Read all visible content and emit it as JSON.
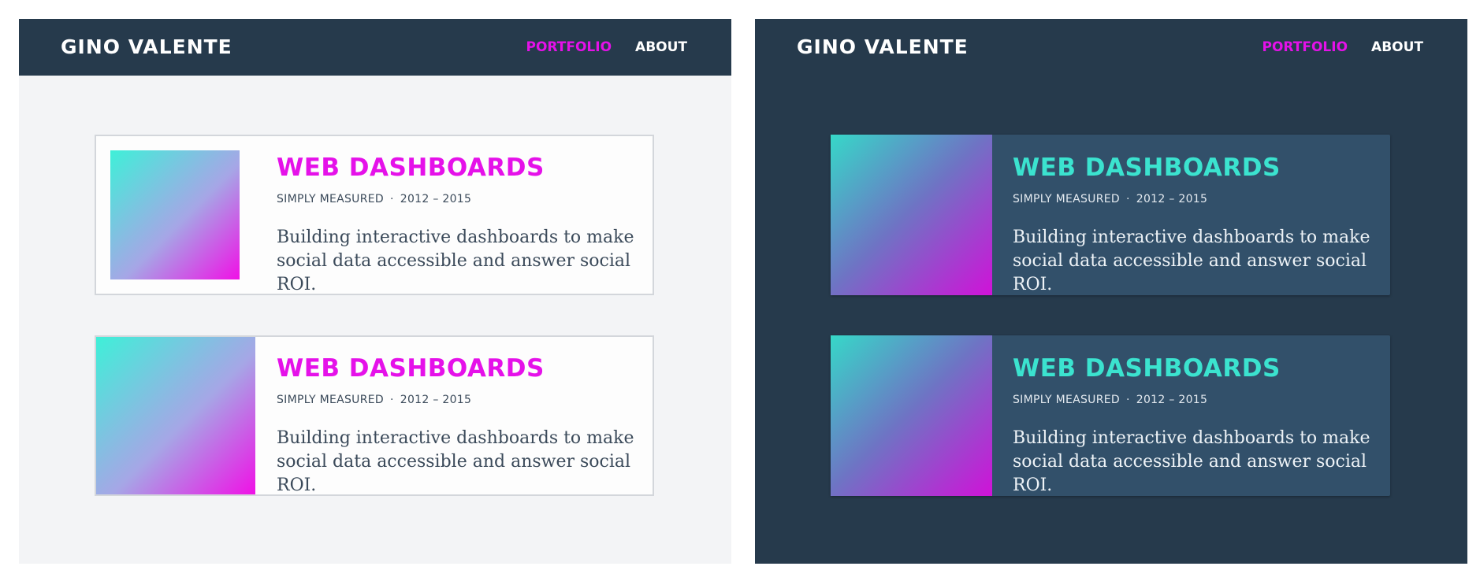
{
  "colors": {
    "navy": "#263a4c",
    "magenta_accent": "#e511e9",
    "teal_accent": "#3be3cf",
    "light_background": "#f3f4f6",
    "dark_card": "#32506a"
  },
  "themes": [
    {
      "name": "light",
      "nav": {
        "brand": "GINO VALENTE",
        "links": [
          {
            "label": "PORTFOLIO",
            "active": true
          },
          {
            "label": "ABOUT",
            "active": false
          }
        ]
      },
      "cards": [
        {
          "title": "WEB DASHBOARDS",
          "company": "SIMPLY MEASURED",
          "separator": "·",
          "years": "2012 – 2015",
          "description": "Building interactive dashboards to make social data accessible and answer social ROI."
        },
        {
          "title": "WEB DASHBOARDS",
          "company": "SIMPLY MEASURED",
          "separator": "·",
          "years": "2012 – 2015",
          "description": "Building interactive dashboards to make social data accessible and answer social ROI."
        }
      ]
    },
    {
      "name": "dark",
      "nav": {
        "brand": "GINO VALENTE",
        "links": [
          {
            "label": "PORTFOLIO",
            "active": true
          },
          {
            "label": "ABOUT",
            "active": false
          }
        ]
      },
      "cards": [
        {
          "title": "WEB DASHBOARDS",
          "company": "SIMPLY MEASURED",
          "separator": "·",
          "years": "2012 – 2015",
          "description": "Building interactive dashboards to make social data accessible and answer social ROI."
        },
        {
          "title": "WEB DASHBOARDS",
          "company": "SIMPLY MEASURED",
          "separator": "·",
          "years": "2012 – 2015",
          "description": "Building interactive dashboards to make social data accessible and answer social ROI."
        }
      ]
    }
  ]
}
